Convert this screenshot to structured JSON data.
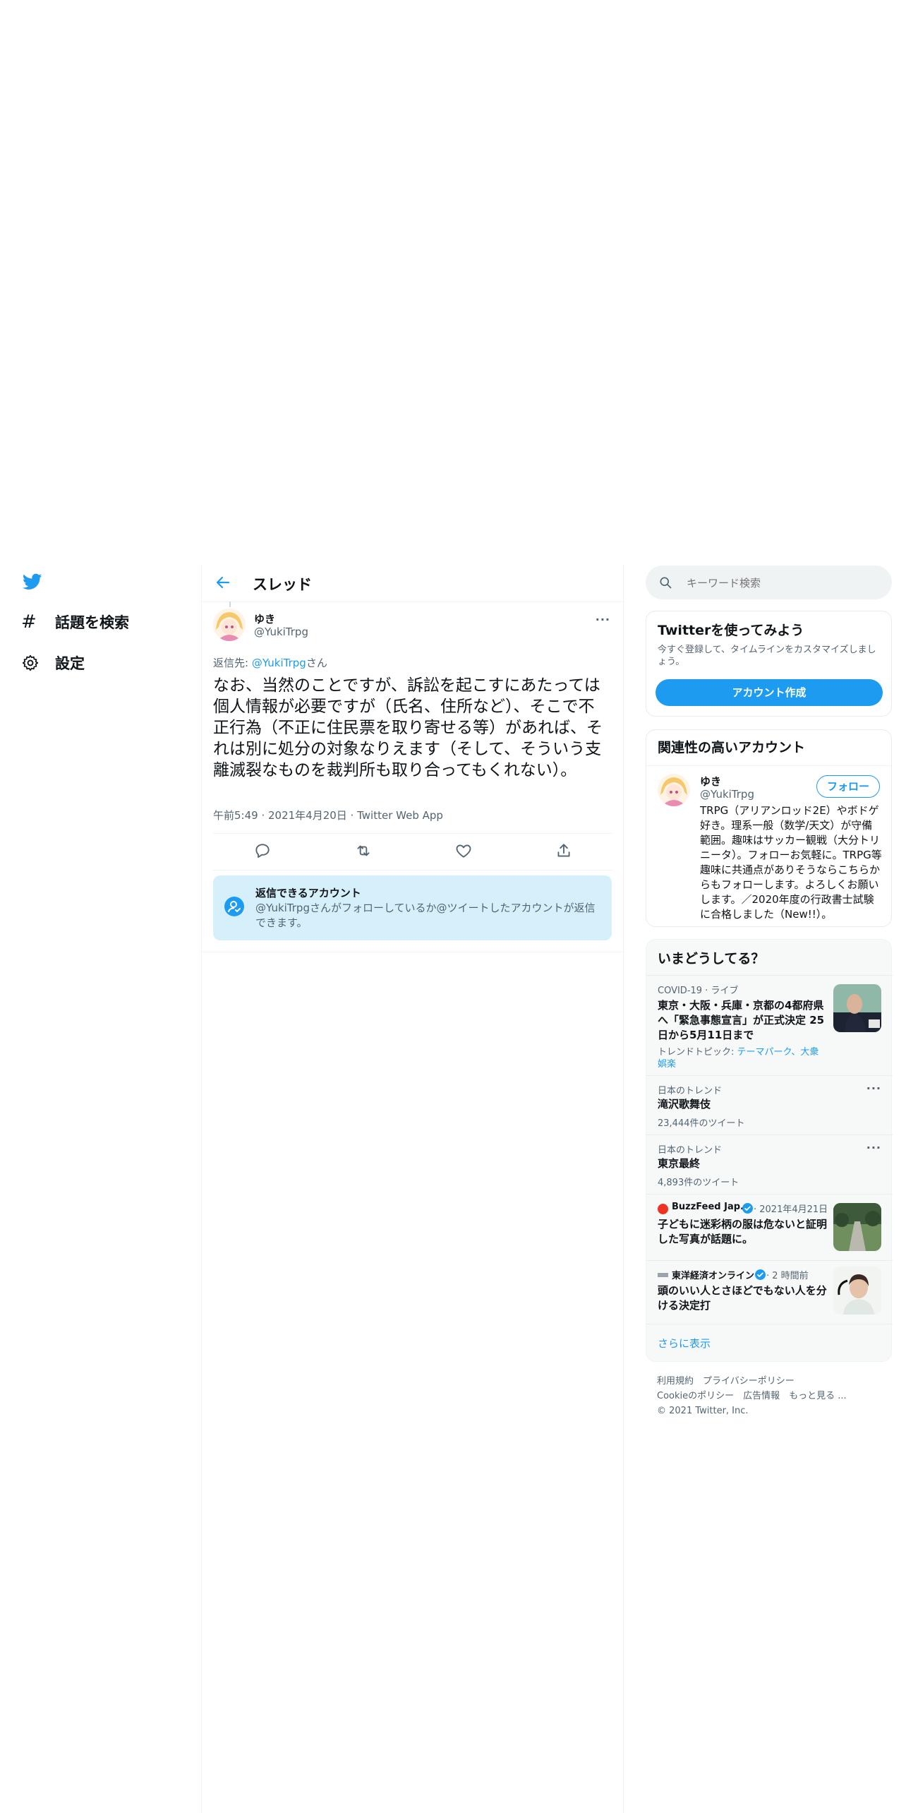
{
  "nav": {
    "explore_label": "話題を検索",
    "settings_label": "設定"
  },
  "header": {
    "title": "スレッド"
  },
  "tweet": {
    "display_name": "ゆき",
    "handle": "@YukiTrpg",
    "reply_prefix": "返信先: ",
    "reply_to": "@YukiTrpg",
    "reply_suffix": "さん",
    "text": "なお、当然のことですが、訴訟を起こすにあたっては個人情報が必要ですが（氏名、住所など）、そこで不正行為（不正に住民票を取り寄せる等）があれば、それは別に処分の対象なりえます（そして、そういう支離滅裂なものを裁判所も取り合ってもくれない）。",
    "meta": "午前5:49 · 2021年4月20日 · Twitter Web App"
  },
  "reply_notice": {
    "title": "返信できるアカウント",
    "body_handle": "@YukiTrpg",
    "body_rest": "さんがフォローしているか@ツイートしたアカウントが返信できます。"
  },
  "search": {
    "placeholder": "キーワード検索"
  },
  "signup": {
    "title": "Twitterを使ってみよう",
    "desc": "今すぐ登録して、タイムラインをカスタマイズしましょう。",
    "button": "アカウント作成"
  },
  "relevant": {
    "title": "関連性の高いアカウント",
    "name": "ゆき",
    "handle": "@YukiTrpg",
    "follow": "フォロー",
    "bio": "TRPG（アリアンロッド2E）やボドゲ好き。理系一般（数学/天文）が守備範囲。趣味はサッカー観戦（大分トリニータ）。フォローお気軽に。TRPG等趣味に共通点がありそうならこちらからもフォローします。よろしくお願いします。／2020年度の行政書士試験に合格しました（New!!）。"
  },
  "trends": {
    "title": "いまどうしてる？",
    "items": [
      {
        "category": "COVID-19 · ライブ",
        "title": "東京・大阪・兵庫・京都の4都府県へ「緊急事態宣言」が正式決定 25日から5月11日まで",
        "topics_prefix": "トレンドトピック: ",
        "topics": "テーマパーク、大衆娯楽"
      },
      {
        "category": "日本のトレンド",
        "title": "滝沢歌舞伎",
        "count": "23,444件のツイート"
      },
      {
        "category": "日本のトレンド",
        "title": "東京最終",
        "count": "4,893件のツイート"
      },
      {
        "source": "BuzzFeed Jap...",
        "time": " · 2021年4月21日",
        "title": "子どもに迷彩柄の服は危ないと証明した写真が話題に。"
      },
      {
        "source": "東洋経済オンライン",
        "time": " · 2 時間前",
        "title": "頭のいい人とさほどでもない人を分ける決定打"
      }
    ],
    "more": "さらに表示"
  },
  "footer": {
    "line1": "利用規約　プライバシーポリシー",
    "line2": "Cookieのポリシー　広告情報　もっと見る ...",
    "copyright": "© 2021 Twitter, Inc."
  },
  "colors": {
    "accent": "#1d9bf0",
    "muted": "#536471",
    "notice_bg": "#d6f0fb"
  }
}
